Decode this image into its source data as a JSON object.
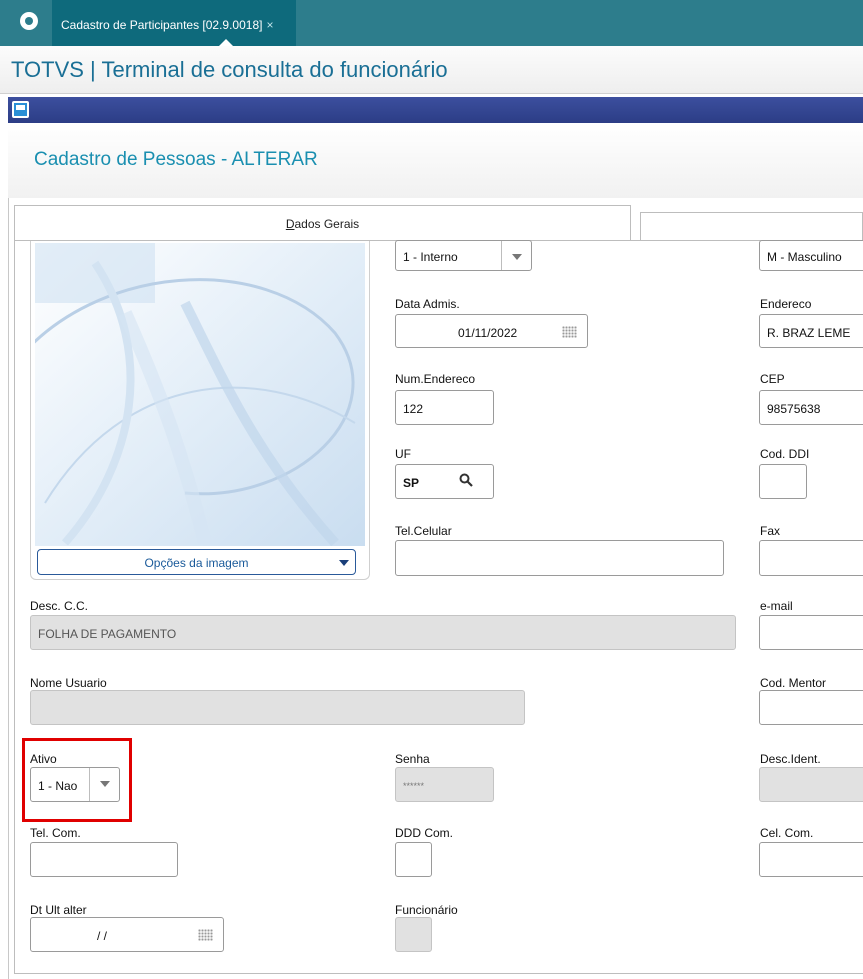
{
  "top_tab": {
    "label": "Cadastro de Participantes [02.9.0018]",
    "close": "×"
  },
  "app_title": "TOTVS | Terminal de consulta do funcionário",
  "page_title": "Cadastro de Pessoas - ALTERAR",
  "tabs": [
    {
      "label_prefix": "D",
      "label_rest": "ados Gerais"
    }
  ],
  "image_options_button": "Opções da imagem",
  "fields": {
    "tipo": {
      "value": "1 - Interno"
    },
    "sexo": {
      "value": "M - Masculino"
    },
    "data_admis": {
      "label": "Data Admis.",
      "value": "01/11/2022"
    },
    "endereco": {
      "label": "Endereco",
      "value": "R. BRAZ LEME"
    },
    "num_endereco": {
      "label": "Num.Endereco",
      "value": "122"
    },
    "cep": {
      "label": "CEP",
      "value": "98575638"
    },
    "uf": {
      "label": "UF",
      "value": "SP"
    },
    "cod_ddi": {
      "label": "Cod. DDI",
      "value": ""
    },
    "tel_celular": {
      "label": "Tel.Celular",
      "value": ""
    },
    "fax": {
      "label": "Fax",
      "value": ""
    },
    "desc_cc": {
      "label": "Desc. C.C.",
      "value": "FOLHA DE PAGAMENTO"
    },
    "email": {
      "label": "e-mail",
      "value": ""
    },
    "nome_usuario": {
      "label": "Nome Usuario",
      "value": ""
    },
    "cod_mentor": {
      "label": "Cod. Mentor",
      "value": ""
    },
    "ativo": {
      "label": "Ativo",
      "value": "1 - Nao"
    },
    "senha": {
      "label": "Senha",
      "value": "******"
    },
    "desc_ident": {
      "label": "Desc.Ident.",
      "value": ""
    },
    "tel_com": {
      "label": "Tel. Com.",
      "value": ""
    },
    "ddd_com": {
      "label": "DDD Com.",
      "value": ""
    },
    "cel_com": {
      "label": "Cel. Com.",
      "value": ""
    },
    "dt_ult_alter": {
      "label": "Dt Ult alter",
      "value": "/ /"
    },
    "funcionario": {
      "label": "Funcionário",
      "value": ""
    }
  },
  "colors": {
    "topbar": "#2d7d8c",
    "active_tab": "#0e6a7c",
    "title_text": "#1a6f95",
    "page_title_text": "#1a8fb0",
    "window_strip": "#2c3d86",
    "highlight": "#e00000"
  },
  "icons": {
    "logo": "totvs-logo-icon",
    "window": "window-icon",
    "calendar": "calendar-icon",
    "search": "search-icon",
    "dropdown": "chevron-down-icon"
  }
}
